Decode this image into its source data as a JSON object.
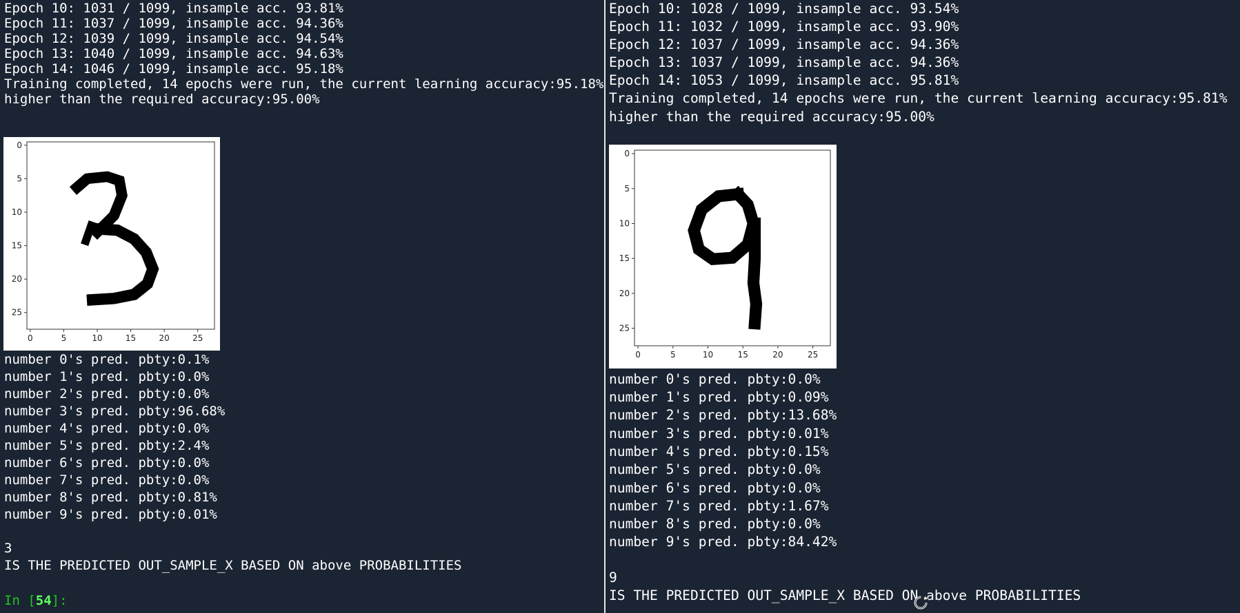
{
  "left": {
    "epochs": [
      "Epoch 10: 1031 / 1099, insample acc. 93.81%",
      "Epoch 11: 1037 / 1099, insample acc. 94.36%",
      "Epoch 12: 1039 / 1099, insample acc. 94.54%",
      "Epoch 13: 1040 / 1099, insample acc. 94.63%",
      "Epoch 14: 1046 / 1099, insample acc. 95.18%"
    ],
    "summary_1": "Training completed, 14 epochs were run, the current learning accuracy:95.18%",
    "summary_2": "higher than the required accuracy:95.00%",
    "plot": {
      "xticks": [
        "0",
        "5",
        "10",
        "15",
        "20",
        "25"
      ],
      "yticks": [
        "0",
        "5",
        "10",
        "15",
        "20",
        "25"
      ]
    },
    "predictions": [
      "number 0's pred. pbty:0.1%",
      "number 1's pred. pbty:0.0%",
      "number 2's pred. pbty:0.0%",
      "number 3's pred. pbty:96.68%",
      "number 4's pred. pbty:0.0%",
      "number 5's pred. pbty:2.4%",
      "number 6's pred. pbty:0.0%",
      "number 7's pred. pbty:0.0%",
      "number 8's pred. pbty:0.81%",
      "number 9's pred. pbty:0.01%"
    ],
    "predicted": "3",
    "result_text": "IS THE PREDICTED OUT_SAMPLE_X BASED ON above PROBABILITIES",
    "prompt_in": "In [",
    "prompt_num": "54",
    "prompt_close": "]:"
  },
  "right": {
    "epochs": [
      "Epoch 10: 1028 / 1099, insample acc. 93.54%",
      "Epoch 11: 1032 / 1099, insample acc. 93.90%",
      "Epoch 12: 1037 / 1099, insample acc. 94.36%",
      "Epoch 13: 1037 / 1099, insample acc. 94.36%",
      "Epoch 14: 1053 / 1099, insample acc. 95.81%"
    ],
    "summary_1": "Training completed, 14 epochs were run, the current learning accuracy:95.81%",
    "summary_2": "higher than the required accuracy:95.00%",
    "plot": {
      "xticks": [
        "0",
        "5",
        "10",
        "15",
        "20",
        "25"
      ],
      "yticks": [
        "0",
        "5",
        "10",
        "15",
        "20",
        "25"
      ]
    },
    "predictions": [
      "number 0's pred. pbty:0.0%",
      "number 1's pred. pbty:0.09%",
      "number 2's pred. pbty:13.68%",
      "number 3's pred. pbty:0.01%",
      "number 4's pred. pbty:0.15%",
      "number 5's pred. pbty:0.0%",
      "number 6's pred. pbty:0.0%",
      "number 7's pred. pbty:1.67%",
      "number 8's pred. pbty:0.0%",
      "number 9's pred. pbty:84.42%"
    ],
    "predicted": "9",
    "result_text": "IS THE PREDICTED OUT_SAMPLE_X BASED ON above PROBABILITIES"
  },
  "colors": {
    "background": "#1b2432",
    "text": "#ffffff",
    "prompt": "#22c222",
    "prompt_number": "#5cff5c"
  },
  "icons": {
    "cursor": "busy-cursor-icon"
  }
}
